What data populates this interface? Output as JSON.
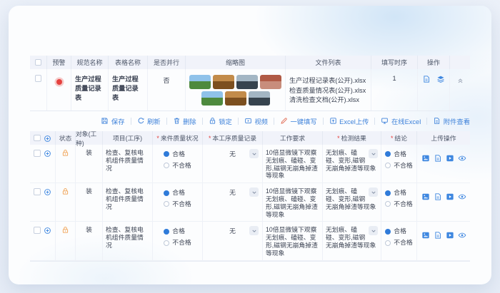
{
  "colors": {
    "accent_blue": "#3e82da",
    "icon_blue": "#3e87e0",
    "alert_red": "#e5413e",
    "lock_orange": "#f0a050",
    "header_bg": "#f1f3fa",
    "selected_radio": "#2f7bd9"
  },
  "required_mark": "*",
  "icons": {
    "top_row_ops": [
      "file-icon",
      "layers-icon"
    ],
    "detail_row_ops": [
      "image-icon",
      "file-icon",
      "video-icon",
      "eye-icon"
    ],
    "toolbar": [
      "save-icon",
      "refresh-icon",
      "trash-icon",
      "lock-icon",
      "video-icon",
      "pen-icon",
      "excel-upload-icon",
      "monitor-icon",
      "attachment-icon"
    ]
  },
  "top_table": {
    "headers": [
      "预警",
      "规范名称",
      "表格名称",
      "是否并行",
      "缩略图",
      "文件列表",
      "填写时序",
      "操作"
    ],
    "row": {
      "spec_name": "生产过程质量记录表",
      "form_name": "生产过程质量记录表",
      "is_parallel": "否",
      "thumbnails": [
        {
          "type": "landscape",
          "sky": "#8fc2ea",
          "ground": "#4e8a3e"
        },
        {
          "type": "autumn",
          "sky": "#c28b4a",
          "ground": "#7c4f1f"
        },
        {
          "type": "cliff",
          "sky": "#a3b6c4",
          "ground": "#36434e"
        },
        {
          "type": "temple",
          "sky": "#b05a45",
          "ground": "#c88d7c"
        },
        {
          "type": "landscape",
          "sky": "#8fc2ea",
          "ground": "#4e8a3e"
        },
        {
          "type": "autumn",
          "sky": "#c28b4a",
          "ground": "#7c4f1f"
        },
        {
          "type": "cliff",
          "sky": "#a3b6c4",
          "ground": "#36434e"
        }
      ],
      "files": [
        "生产过程记录表(公开).xlsx",
        "检查质量情况表(公开).xlsx",
        "清洗检查文档(公开).xlsx"
      ],
      "fill_order": "1"
    }
  },
  "toolbar": {
    "save": "保存",
    "refresh": "刷新",
    "delete": "删除",
    "lock": "锁定",
    "video": "视频",
    "one_click_fill": "一键填写",
    "excel_upload": "Excel上传",
    "online_excel": "在线Excel",
    "attachment_view": "附件查看"
  },
  "detail_table": {
    "headers": [
      "状态",
      "对象(工种)",
      "项目(工序)",
      "来件质量状况",
      "本工序质量记录",
      "工作要求",
      "检测结果",
      "结论",
      "上传操作"
    ],
    "rows": [
      {
        "object_type": "装",
        "project": "检查、复核电机组件质量情况",
        "incoming_quality": {
          "selected": "合格",
          "options": [
            "合格",
            "不合格"
          ]
        },
        "process_record_value": "无",
        "work_requirement": "10倍显微镜下观察无划痕、磕碰、变形,磁钢无崩角掉渣等现象",
        "test_result": "无划痕、磕碰、变形,磁钢无崩角掉渣等现象",
        "conclusion": {
          "selected": "合格",
          "options": [
            "合格",
            "不合格"
          ]
        }
      },
      {
        "object_type": "装",
        "project": "检查、复核电机组件质量情况",
        "incoming_quality": {
          "selected": "合格",
          "options": [
            "合格",
            "不合格"
          ]
        },
        "process_record_value": "无",
        "work_requirement": "10倍显微镜下观察无划痕、磕碰、变形,磁钢无崩角掉渣等现象",
        "test_result": "无划痕、磕碰、变形,磁钢无崩角掉渣等现象",
        "conclusion": {
          "selected": "合格",
          "options": [
            "合格",
            "不合格"
          ]
        }
      },
      {
        "object_type": "装",
        "project": "检查、复核电机组件质量情况",
        "incoming_quality": {
          "selected": "合格",
          "options": [
            "合格",
            "不合格"
          ]
        },
        "process_record_value": "无",
        "work_requirement": "10倍显微镜下观察无划痕、磕碰、变形,磁钢无崩角掉渣等现象",
        "test_result": "无划痕、磕碰、变形,磁钢无崩角掉渣等现象",
        "conclusion": {
          "selected": "合格",
          "options": [
            "合格",
            "不合格"
          ]
        }
      }
    ]
  }
}
